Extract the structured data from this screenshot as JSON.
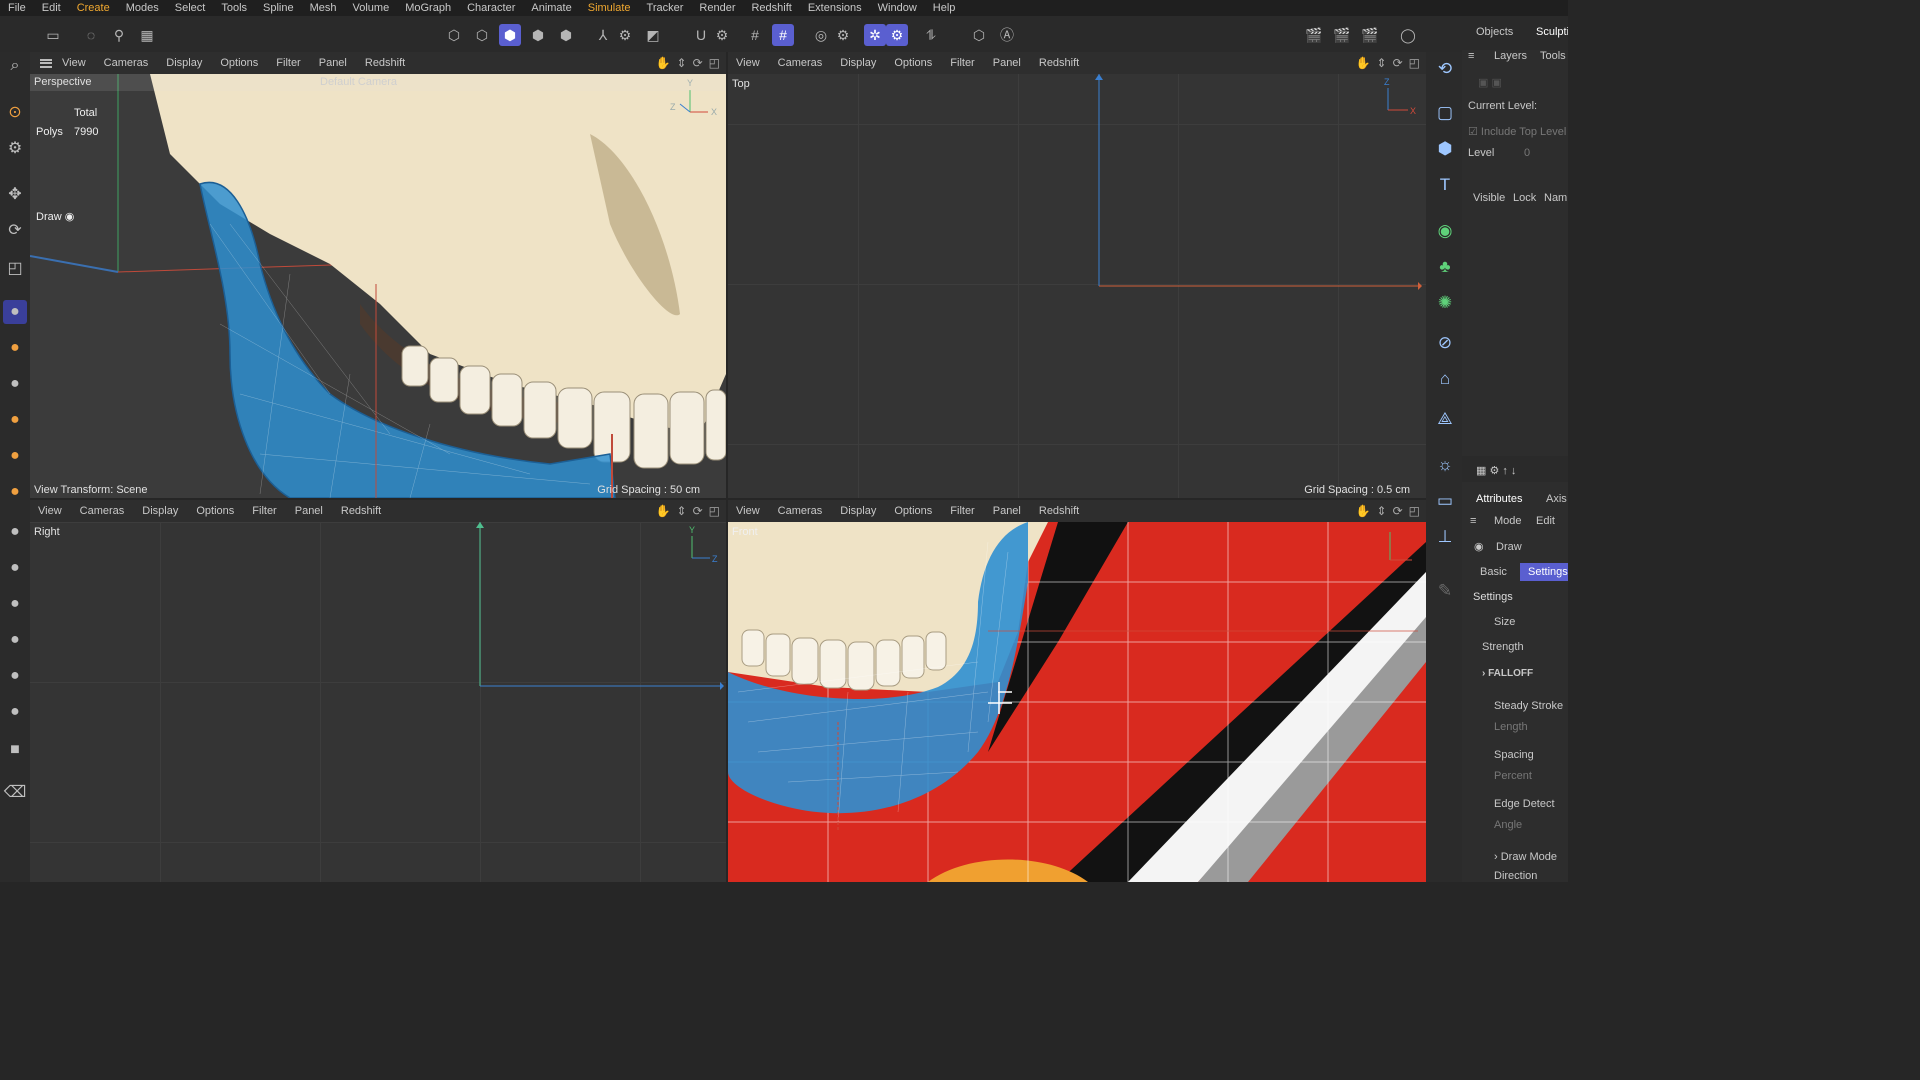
{
  "menubar": [
    "File",
    "Edit",
    "Create",
    "Modes",
    "Select",
    "Tools",
    "Spline",
    "Mesh",
    "Volume",
    "MoGraph",
    "Character",
    "Animate",
    "Simulate",
    "Tracker",
    "Render",
    "Redshift",
    "Extensions",
    "Window",
    "Help"
  ],
  "viewport_menu": [
    "View",
    "Cameras",
    "Display",
    "Options",
    "Filter",
    "Panel",
    "Redshift"
  ],
  "viewports": {
    "perspective": {
      "name": "Perspective",
      "camera": "Default Camera",
      "stats_total_label": "Total",
      "stats_polys_label": "Polys",
      "stats_polys_value": "7990",
      "draw_label": "Draw",
      "view_transform": "View Transform: Scene",
      "grid_spacing": "Grid Spacing : 50 cm"
    },
    "top": {
      "name": "Top",
      "grid_spacing": "Grid Spacing : 0.5 cm"
    },
    "right": {
      "name": "Right"
    },
    "front": {
      "name": "Front"
    }
  },
  "right_panel": {
    "tab_objects": "Objects",
    "tab_sculpt": "Sculpti",
    "layers": "Layers",
    "tools": "Tools",
    "current_level": "Current Level:",
    "include_top": "Include Top Level",
    "level_label": "Level",
    "level_value": "0",
    "visible": "Visible",
    "lock": "Lock",
    "name": "Nam",
    "attributes": "Attributes",
    "axis": "Axis",
    "mode": "Mode",
    "edit": "Edit",
    "draw": "Draw",
    "basic": "Basic",
    "settings_tab": "Settings",
    "settings_header": "Settings",
    "size": "Size",
    "strength": "Strength",
    "falloff": "FALLOFF",
    "steady_stroke": "Steady Stroke",
    "length": "Length",
    "spacing": "Spacing",
    "percent": "Percent",
    "edge_detect": "Edge Detect",
    "angle": "Angle",
    "draw_mode": "Draw Mode",
    "direction": "Direction"
  },
  "colors": {
    "accent": "#5a5fd0",
    "menu_active": "#f0a830",
    "wire": "#2f8fd0",
    "bone": "#efe3c6"
  }
}
